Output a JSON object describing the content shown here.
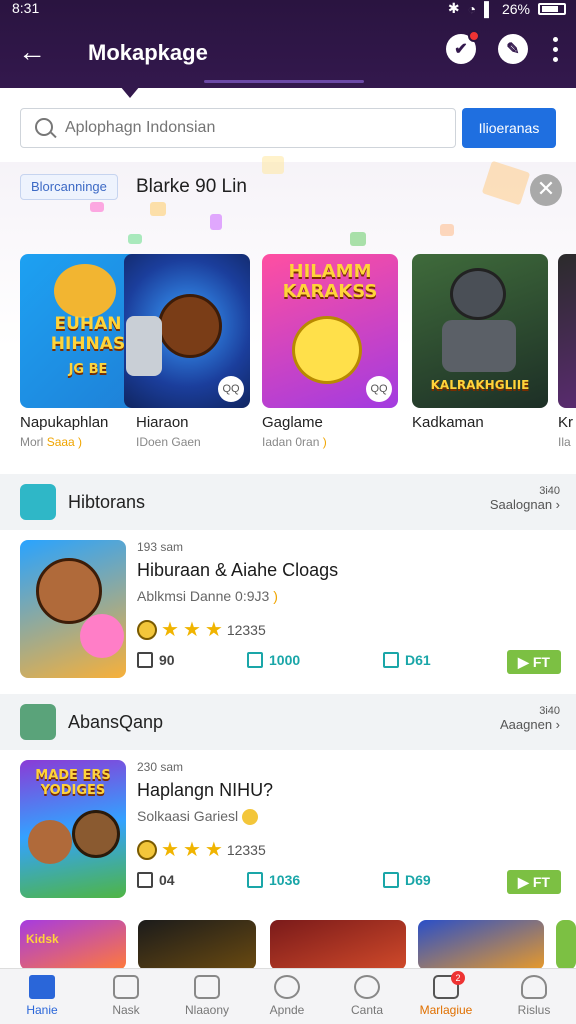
{
  "status": {
    "time": "8:31",
    "battery": "26%"
  },
  "header": {
    "title": "Mokapkage",
    "back_icon": "arrow-left-icon",
    "accent": "#33184d"
  },
  "search": {
    "placeholder": "Aplophagn Indonsian",
    "button_label": "Ilioeranas"
  },
  "promo": {
    "tag": "Blorcanninge",
    "title": "Blarke 90 Lin",
    "games": [
      {
        "name": "Napukaphlan",
        "sub": "Morl",
        "sub_hl": "Saaa )",
        "art": "EUHAN HIHNAS",
        "art2": "JG BE",
        "badge": ""
      },
      {
        "name": "Hiaraon",
        "sub": "IDoen Gaen",
        "sub_hl": "",
        "art": "",
        "art2": "",
        "badge": "QQ"
      },
      {
        "name": "Gaglame",
        "sub": "Iadan 0ran",
        "sub_hl": ")",
        "art": "HILAMM KARAKSS",
        "art2": "",
        "badge": "QQ"
      },
      {
        "name": "Kadkaman",
        "sub": "",
        "sub_hl": "",
        "art": "KALRAKHGLIIE",
        "art2": "",
        "badge": ""
      },
      {
        "name": "Kr",
        "sub": "Ila",
        "sub_hl": "",
        "art": "",
        "art2": "",
        "badge": ""
      }
    ]
  },
  "sections": [
    {
      "title": "Hibtorans",
      "more_small": "3i40",
      "more": "Saalognan ›",
      "card": {
        "meta": "193 sam",
        "title": "Hiburaan & Aiahe Cloags",
        "sub": "Ablkmsi Danne 0:9J3",
        "sub_hl": ")",
        "rating": "12335",
        "stats": [
          "90",
          "1000",
          "D61"
        ],
        "play": "FT"
      }
    },
    {
      "title": "AbansQanp",
      "more_small": "3i40",
      "more": "Aaagnen ›",
      "card": {
        "meta": "230 sam",
        "title": "Haplangn NIHU?",
        "sub": "Solkaasi Gariesl",
        "sub_hl": "",
        "rating": "12335",
        "stats": [
          "04",
          "1036",
          "D69"
        ],
        "play": "FT"
      }
    }
  ],
  "card_art": [
    "",
    "MADE ERS YODIGES"
  ],
  "bottom_strip_art": [
    "Kidsk",
    "",
    "",
    "",
    ""
  ],
  "nav": [
    {
      "label": "Hanie",
      "icon": "home-icon"
    },
    {
      "label": "Nask",
      "icon": "book-icon"
    },
    {
      "label": "Nlaaony",
      "icon": "gamepad-icon"
    },
    {
      "label": "Apnde",
      "icon": "clock-icon"
    },
    {
      "label": "Canta",
      "icon": "chat-icon"
    },
    {
      "label": "Marlagiue",
      "icon": "bag-icon",
      "badge": "2"
    },
    {
      "label": "Rislus",
      "icon": "user-icon"
    }
  ]
}
